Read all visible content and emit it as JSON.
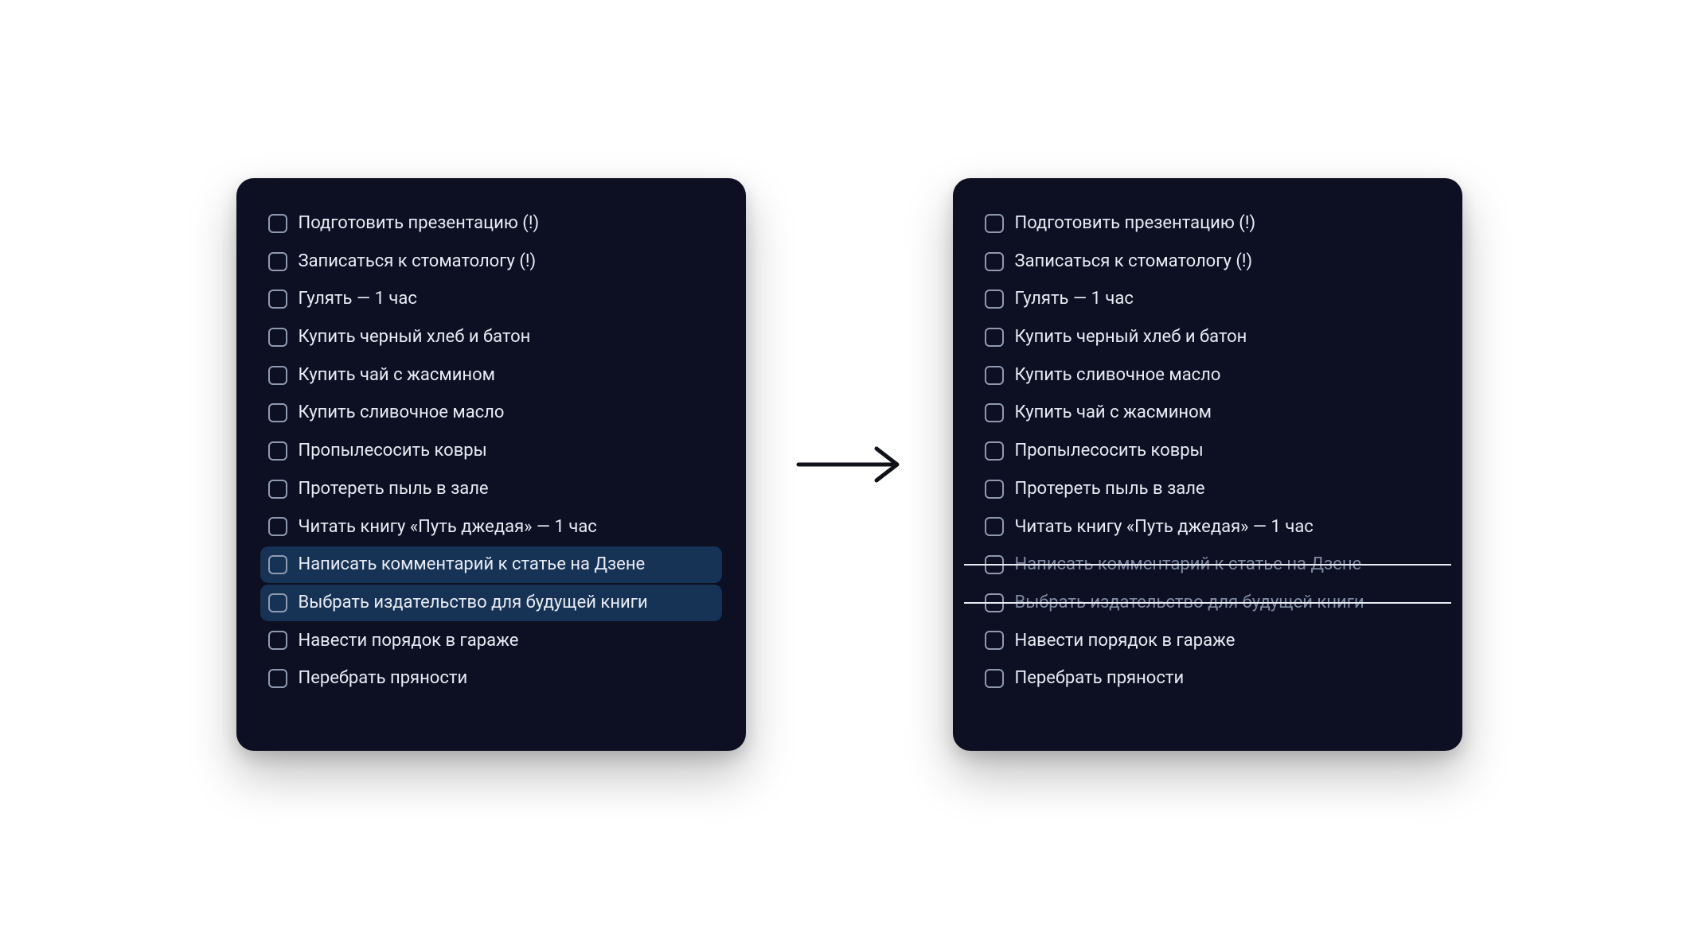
{
  "leftPanel": {
    "items": [
      {
        "label": "Подготовить презентацию (!)",
        "selected": false,
        "struck": false
      },
      {
        "label": "Записаться к стоматологу (!)",
        "selected": false,
        "struck": false
      },
      {
        "label": "Гулять — 1 час",
        "selected": false,
        "struck": false
      },
      {
        "label": "Купить черный хлеб и батон",
        "selected": false,
        "struck": false
      },
      {
        "label": "Купить чай с жасмином",
        "selected": false,
        "struck": false
      },
      {
        "label": "Купить сливочное масло",
        "selected": false,
        "struck": false
      },
      {
        "label": "Пропылесосить ковры",
        "selected": false,
        "struck": false
      },
      {
        "label": "Протереть пыль в зале",
        "selected": false,
        "struck": false
      },
      {
        "label": "Читать книгу «Путь джедая» — 1 час",
        "selected": false,
        "struck": false
      },
      {
        "label": "Написать комментарий к статье на Дзене",
        "selected": true,
        "struck": false
      },
      {
        "label": "Выбрать издательство для будущей книги",
        "selected": true,
        "struck": false
      },
      {
        "label": "Навести порядок в гараже",
        "selected": false,
        "struck": false
      },
      {
        "label": "Перебрать пряности",
        "selected": false,
        "struck": false
      }
    ]
  },
  "rightPanel": {
    "items": [
      {
        "label": "Подготовить презентацию (!)",
        "selected": false,
        "struck": false
      },
      {
        "label": "Записаться к стоматологу (!)",
        "selected": false,
        "struck": false
      },
      {
        "label": "Гулять — 1 час",
        "selected": false,
        "struck": false
      },
      {
        "label": "Купить черный хлеб и батон",
        "selected": false,
        "struck": false
      },
      {
        "label": "Купить сливочное масло",
        "selected": false,
        "struck": false
      },
      {
        "label": "Купить чай с жасмином",
        "selected": false,
        "struck": false
      },
      {
        "label": "Пропылесосить ковры",
        "selected": false,
        "struck": false
      },
      {
        "label": "Протереть пыль в зале",
        "selected": false,
        "struck": false
      },
      {
        "label": "Читать книгу «Путь джедая» — 1 час",
        "selected": false,
        "struck": false
      },
      {
        "label": "Написать комментарий к статье на Дзене",
        "selected": false,
        "struck": true
      },
      {
        "label": "Выбрать издательство для будущей книги",
        "selected": false,
        "struck": true
      },
      {
        "label": "Навести порядок в гараже",
        "selected": false,
        "struck": false
      },
      {
        "label": "Перебрать пряности",
        "selected": false,
        "struck": false
      }
    ]
  },
  "colors": {
    "panelBg": "#0d0f22",
    "text": "#e9ecf4",
    "checkboxBorder": "#8f9ab0",
    "selectedBg": "#163355",
    "struckText": "#7f8aa1",
    "arrow": "#101219"
  }
}
